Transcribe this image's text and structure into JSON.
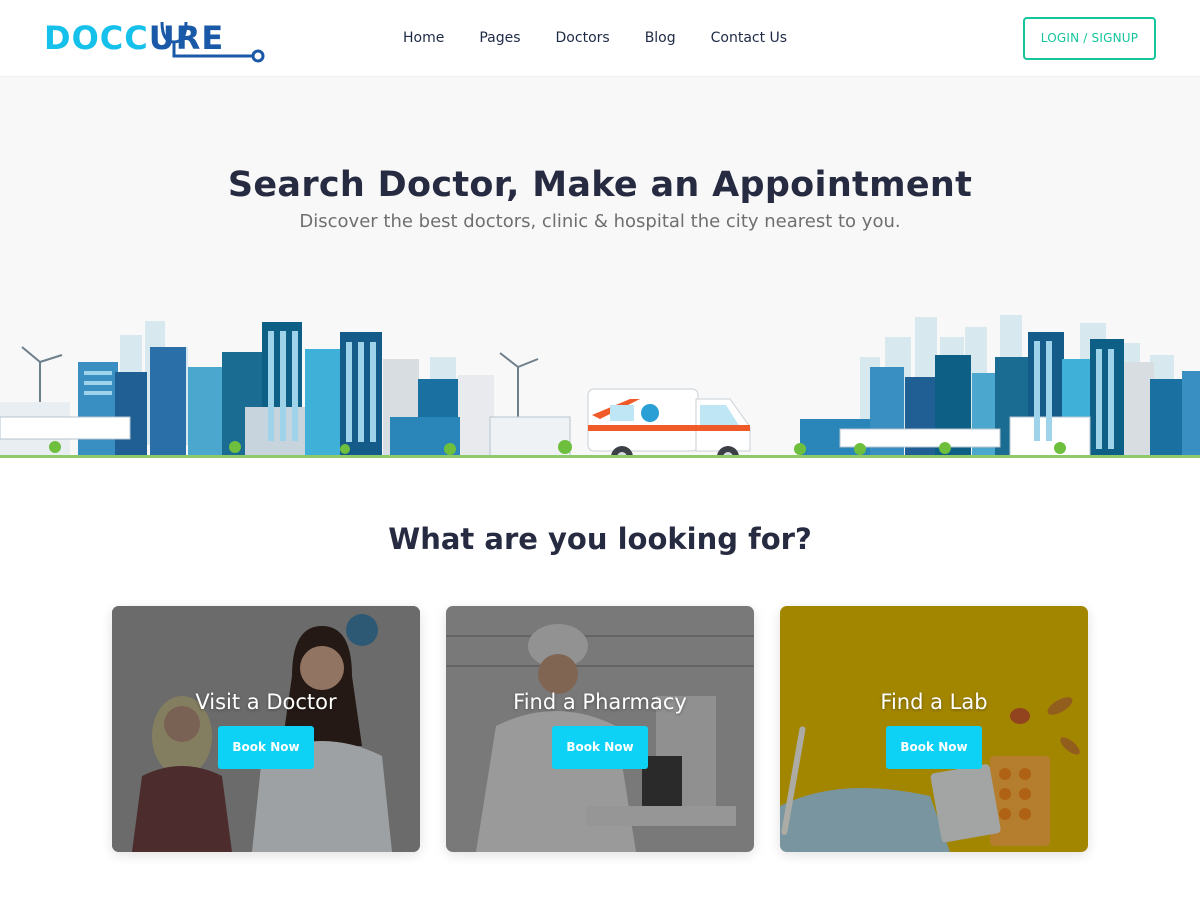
{
  "brand": {
    "logo_text_1": "DOCC",
    "logo_text_2": "URE",
    "color_primary": "#15c1ea",
    "color_secondary": "#1a58a8"
  },
  "nav": {
    "items": [
      "Home",
      "Pages",
      "Doctors",
      "Blog",
      "Contact Us"
    ]
  },
  "auth": {
    "login_label": "LOGIN / SIGNUP",
    "accent": "#15c59c"
  },
  "hero": {
    "title": "Search Doctor, Make an Appointment",
    "subtitle": "Discover the best doctors, clinic & hospital the city nearest to you."
  },
  "services": {
    "title": "What are you looking for?",
    "cards": [
      {
        "title": "Visit a Doctor",
        "button": "Book Now"
      },
      {
        "title": "Find a Pharmacy",
        "button": "Book Now"
      },
      {
        "title": "Find a Lab",
        "button": "Book Now"
      }
    ],
    "button_color": "#0ed2f5"
  }
}
